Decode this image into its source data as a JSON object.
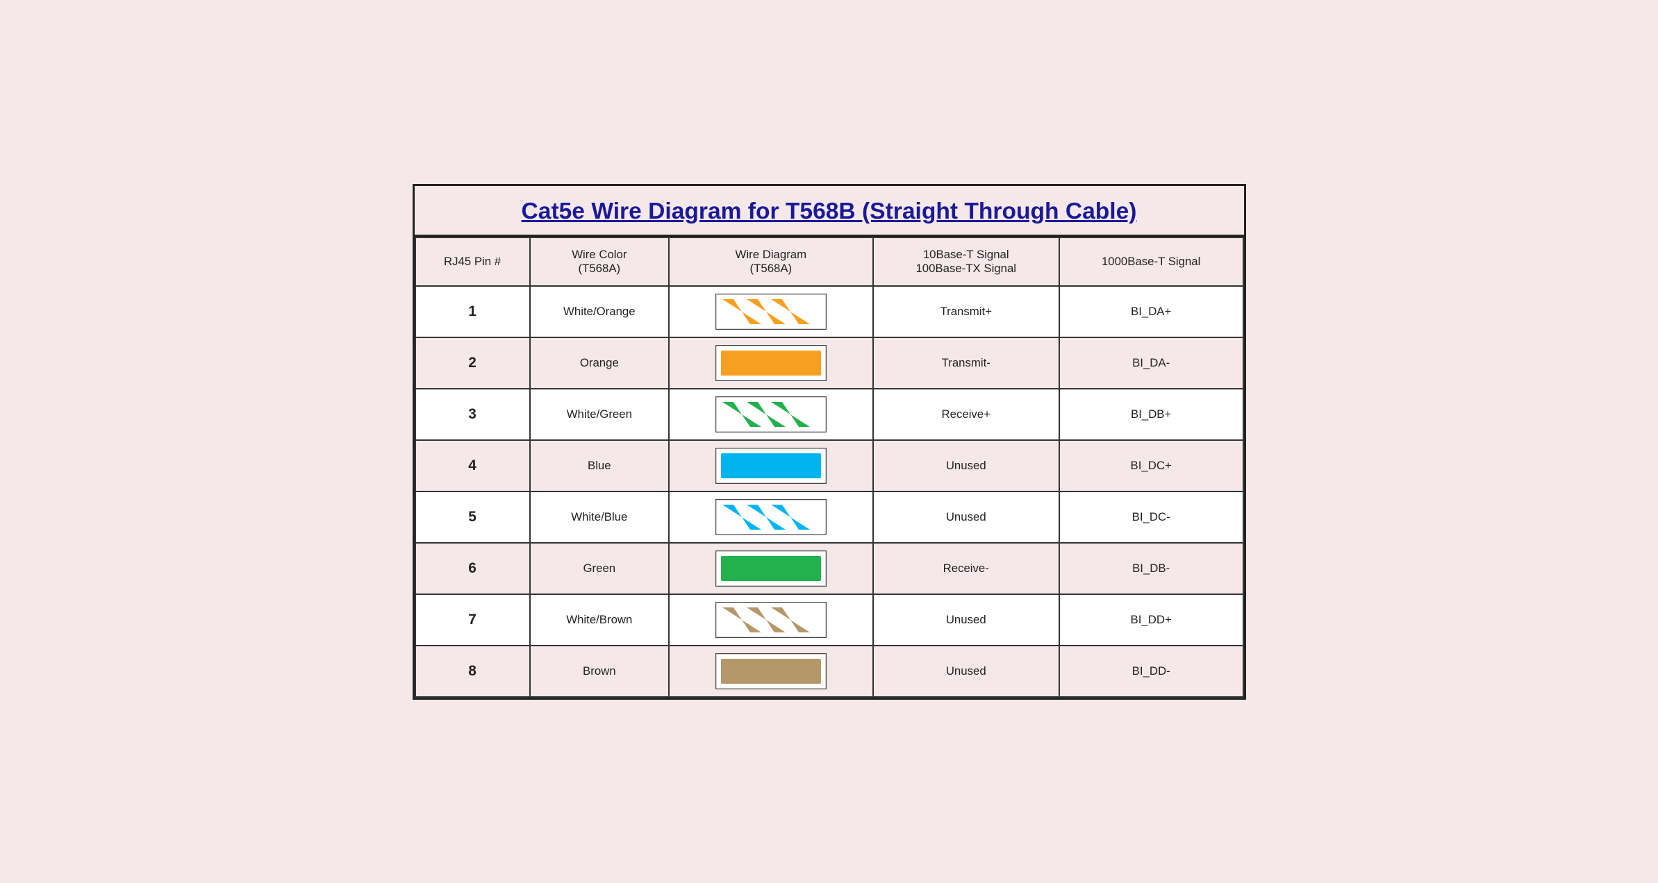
{
  "title": "Cat5e Wire Diagram for T568B (Straight Through Cable)",
  "headers": {
    "col1": "RJ45 Pin #",
    "col2_line1": "Wire Color",
    "col2_line2": "(T568A)",
    "col3_line1": "Wire Diagram",
    "col3_line2": "(T568A)",
    "col4_line1": "10Base-T Signal",
    "col4_line2": "100Base-TX Signal",
    "col5": "1000Base-T Signal"
  },
  "rows": [
    {
      "pin": "1",
      "color": "White/Orange",
      "wire_type": "white_orange_stripe",
      "signal": "Transmit+",
      "gbase": "BI_DA+"
    },
    {
      "pin": "2",
      "color": "Orange",
      "wire_type": "solid_orange",
      "signal": "Transmit-",
      "gbase": "BI_DA-"
    },
    {
      "pin": "3",
      "color": "White/Green",
      "wire_type": "white_green_stripe",
      "signal": "Receive+",
      "gbase": "BI_DB+"
    },
    {
      "pin": "4",
      "color": "Blue",
      "wire_type": "solid_blue",
      "signal": "Unused",
      "gbase": "BI_DC+"
    },
    {
      "pin": "5",
      "color": "White/Blue",
      "wire_type": "white_blue_stripe",
      "signal": "Unused",
      "gbase": "BI_DC-"
    },
    {
      "pin": "6",
      "color": "Green",
      "wire_type": "solid_green",
      "signal": "Receive-",
      "gbase": "BI_DB-"
    },
    {
      "pin": "7",
      "color": "White/Brown",
      "wire_type": "white_brown_stripe",
      "signal": "Unused",
      "gbase": "BI_DD+"
    },
    {
      "pin": "8",
      "color": "Brown",
      "wire_type": "solid_brown",
      "signal": "Unused",
      "gbase": "BI_DD-"
    }
  ]
}
